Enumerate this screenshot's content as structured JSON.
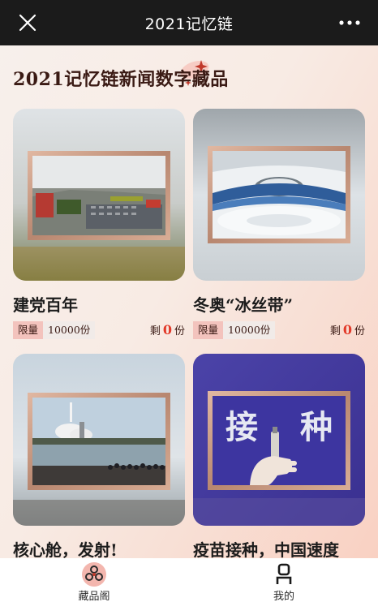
{
  "topbar": {
    "title": "2021记忆链",
    "close_icon": "close-icon",
    "more_icon": "more-dots-icon"
  },
  "header": {
    "title": "2021记忆链新闻数字藏品"
  },
  "cards": [
    {
      "name": "建党百年",
      "limit_label": "限量",
      "limit_value": "10000份",
      "remain_prefix": "剩",
      "remain_count": "0",
      "remain_suffix": "份",
      "image_icon": "parade-square-image"
    },
    {
      "name": "冬奥“冰丝带”",
      "limit_label": "限量",
      "limit_value": "10000份",
      "remain_prefix": "剩",
      "remain_count": "0",
      "remain_suffix": "份",
      "image_icon": "ice-stadium-image"
    },
    {
      "name": "核心舱，发射!",
      "image_icon": "rocket-launch-image"
    },
    {
      "name": "疫苗接种，中国速度",
      "image_icon": "vaccine-image",
      "image_text": [
        "接",
        "种"
      ]
    }
  ],
  "tabbar": {
    "items": [
      {
        "label": "藏品阁",
        "icon": "collection-icon",
        "active": true
      },
      {
        "label": "我的",
        "icon": "profile-icon",
        "active": false
      }
    ]
  },
  "colors": {
    "accent": "#e23a2a",
    "tag_bg": "#f3c3bd",
    "topbar_bg": "#1b1b1b",
    "frame": "#c89b86"
  }
}
